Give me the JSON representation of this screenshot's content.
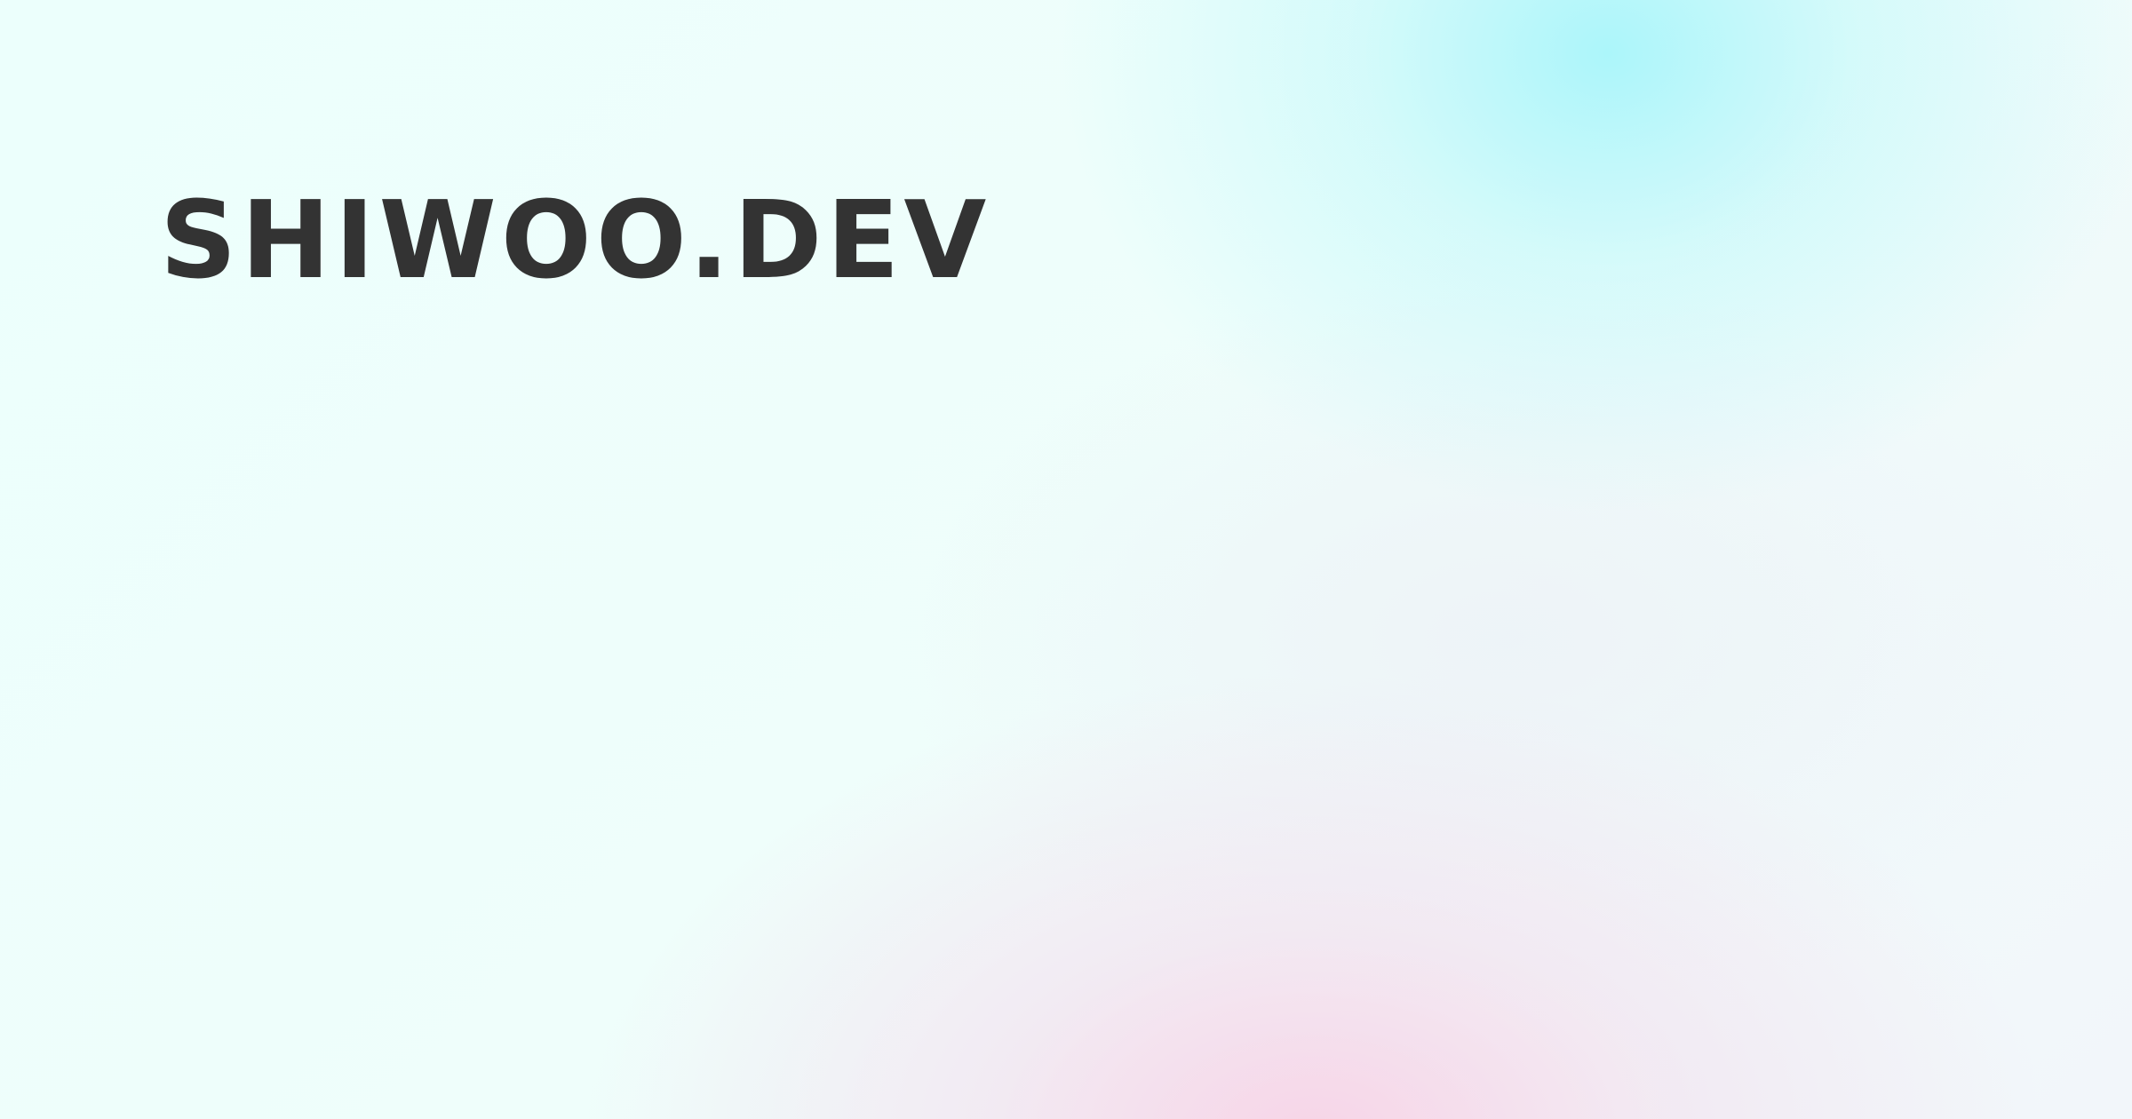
{
  "site": {
    "logo_text": "SHIWOO.DEV"
  },
  "colors": {
    "text": "#333333",
    "background_base": "#eefefb",
    "gradient_cyan": "#a0f4fa",
    "gradient_pink": "#f8cee4"
  }
}
